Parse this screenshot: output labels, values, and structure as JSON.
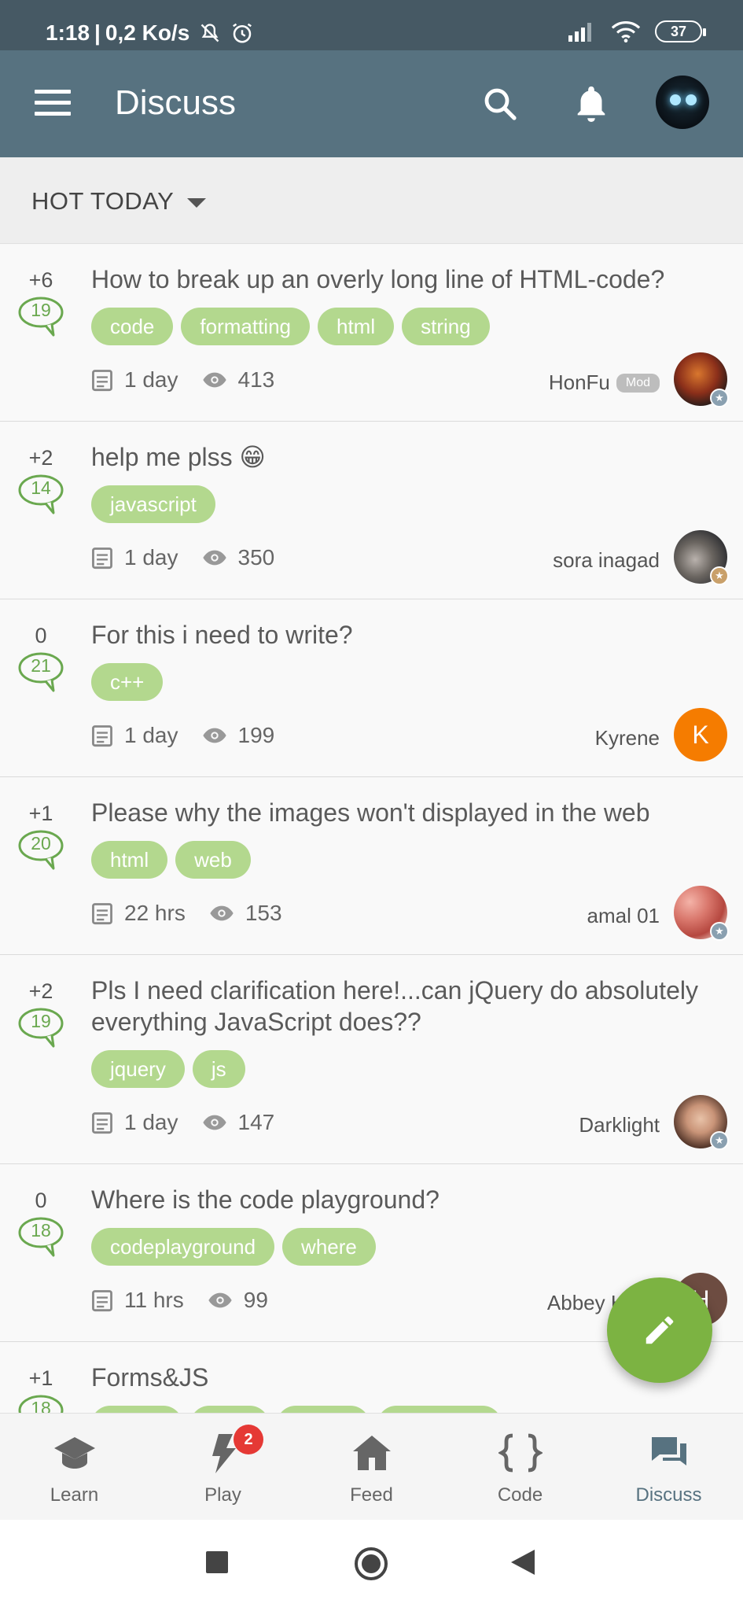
{
  "status_bar": {
    "time": "1:18",
    "speed": "0,2 Ko/s",
    "battery": "37"
  },
  "app_bar": {
    "title": "Discuss"
  },
  "filter": {
    "label": "HOT TODAY"
  },
  "posts": [
    {
      "votes": "+6",
      "answers": "19",
      "title": "How to break up an overly long line of HTML-code?",
      "tags": [
        "code",
        "formatting",
        "html",
        "string"
      ],
      "age": "1 day",
      "views": "413",
      "author": "HonFu",
      "author_badge": "Mod"
    },
    {
      "votes": "+2",
      "answers": "14",
      "title": "help me plss 😁",
      "tags": [
        "javascript"
      ],
      "age": "1 day",
      "views": "350",
      "author": "sora inagad"
    },
    {
      "votes": "0",
      "answers": "21",
      "title": "For this i need to write?",
      "tags": [
        "c++"
      ],
      "age": "1 day",
      "views": "199",
      "author": "Kyrene",
      "avatar_letter": "K"
    },
    {
      "votes": "+1",
      "answers": "20",
      "title": "Please why the images won't displayed in the web",
      "tags": [
        "html",
        "web"
      ],
      "age": "22 hrs",
      "views": "153",
      "author": "amal 01"
    },
    {
      "votes": "+2",
      "answers": "19",
      "title": "Pls I need clarification here!...can jQuery do absolutely everything JavaScript does??",
      "tags": [
        "jquery",
        "js"
      ],
      "age": "1 day",
      "views": "147",
      "author": "Darklight"
    },
    {
      "votes": "0",
      "answers": "18",
      "title": "Where is the code playground?",
      "tags": [
        "codeplayground",
        "where"
      ],
      "age": "11 hrs",
      "views": "99",
      "author": "Abbey Hofm",
      "avatar_letter": "H"
    },
    {
      "votes": "+1",
      "answers": "18",
      "title": "Forms&JS"
    }
  ],
  "bottom_nav": {
    "learn": "Learn",
    "play": "Play",
    "play_badge": "2",
    "feed": "Feed",
    "code": "Code",
    "discuss": "Discuss"
  },
  "colors": {
    "appbar": "#577280",
    "tag": "#b3d88e",
    "fab": "#7cb342",
    "accent_green": "#6aa84f"
  }
}
